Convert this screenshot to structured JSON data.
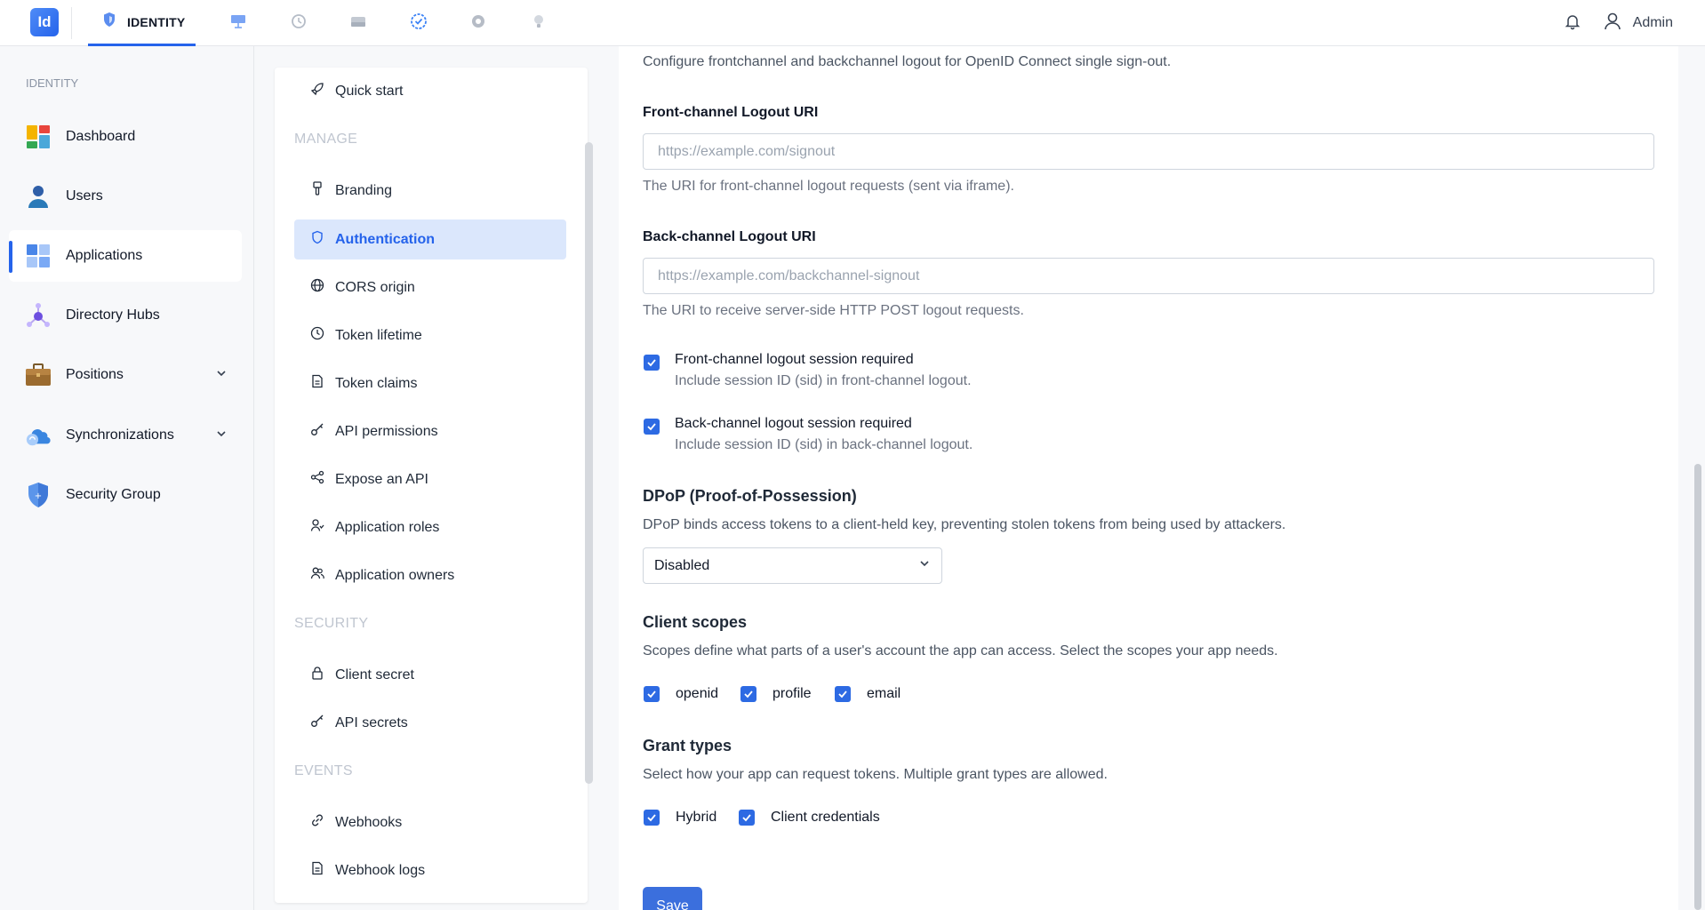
{
  "topbar": {
    "logo": "Id",
    "active_tab": "IDENTITY",
    "user": "Admin",
    "icons": [
      "shield-icon",
      "presentation-icon",
      "history-icon",
      "drive-icon",
      "badge-check-icon",
      "gear-icon",
      "bulb-icon",
      "bell-icon",
      "user-icon"
    ]
  },
  "sidebar": {
    "heading": "IDENTITY",
    "items": [
      {
        "label": "Dashboard"
      },
      {
        "label": "Users"
      },
      {
        "label": "Applications"
      },
      {
        "label": "Directory Hubs"
      },
      {
        "label": "Positions"
      },
      {
        "label": "Synchronizations"
      },
      {
        "label": "Security Group"
      }
    ]
  },
  "subnav": {
    "quick_start": "Quick start",
    "manage_heading": "MANAGE",
    "manage": [
      "Branding",
      "Authentication",
      "CORS origin",
      "Token lifetime",
      "Token claims",
      "API permissions",
      "Expose an API",
      "Application roles",
      "Application owners"
    ],
    "security_heading": "SECURITY",
    "security": [
      "Client secret",
      "API secrets"
    ],
    "events_heading": "EVENTS",
    "events": [
      "Webhooks",
      "Webhook logs"
    ]
  },
  "main": {
    "logout_desc": "Configure frontchannel and backchannel logout for OpenID Connect single sign-out.",
    "front_label": "Front-channel Logout URI",
    "front_placeholder": "https://example.com/signout",
    "front_help": "The URI for front-channel logout requests (sent via iframe).",
    "back_label": "Back-channel Logout URI",
    "back_placeholder": "https://example.com/backchannel-signout",
    "back_help": "The URI to receive server-side HTTP POST logout requests.",
    "front_session_label": "Front-channel logout session required",
    "front_session_help": "Include session ID (sid) in front-channel logout.",
    "back_session_label": "Back-channel logout session required",
    "back_session_help": "Include session ID (sid) in back-channel logout.",
    "dpop_title": "DPoP (Proof-of-Possession)",
    "dpop_desc": "DPoP binds access tokens to a client-held key, preventing stolen tokens from being used by attackers.",
    "dpop_value": "Disabled",
    "scopes_title": "Client scopes",
    "scopes_desc": "Scopes define what parts of a user's account the app can access. Select the scopes your app needs.",
    "scopes": [
      "openid",
      "profile",
      "email"
    ],
    "grants_title": "Grant types",
    "grants_desc": "Select how your app can request tokens. Multiple grant types are allowed.",
    "grants": [
      "Hybrid",
      "Client credentials"
    ],
    "save_label": "Save"
  }
}
